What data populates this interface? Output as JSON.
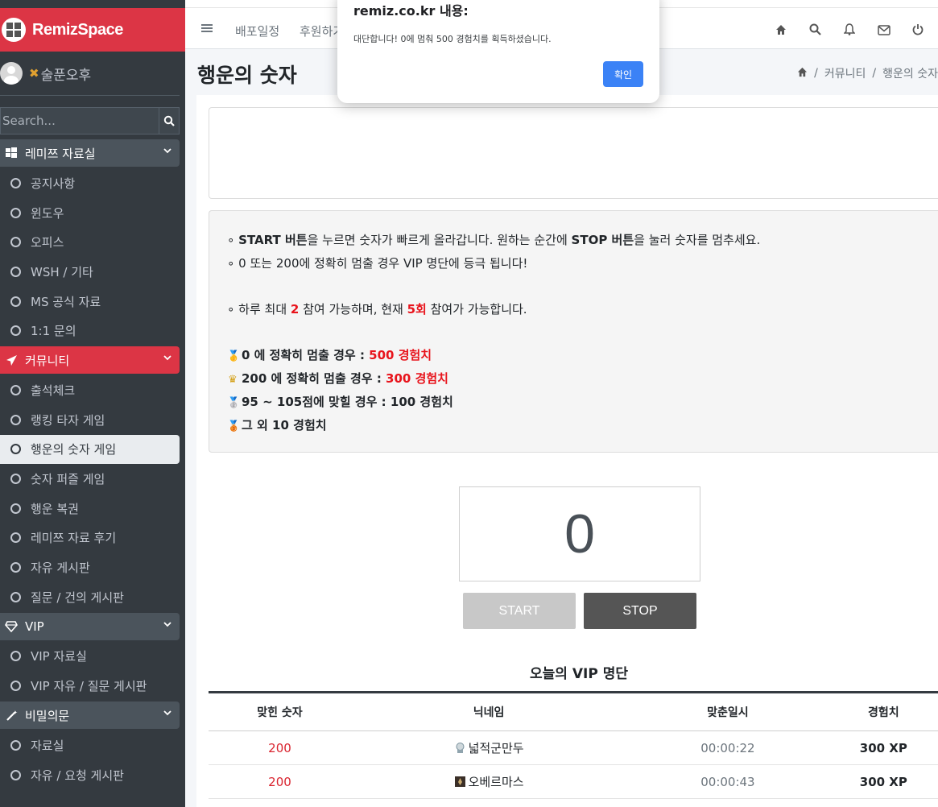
{
  "brand": {
    "name": "RemizSpace"
  },
  "user": {
    "name": "술푼오후"
  },
  "search": {
    "placeholder": "Search..."
  },
  "nav": {
    "sections": [
      {
        "label": "레미쯔 자료실",
        "items": [
          "공지사항",
          "윈도우",
          "오피스",
          "WSH / 기타",
          "MS 공식 자료",
          "1:1 문의"
        ]
      },
      {
        "label": "커뮤니티",
        "items": [
          "출석체크",
          "랭킹 타자 게임",
          "행운의 숫자 게임",
          "숫자 퍼즐 게임",
          "행운 복권",
          "레미쯔 자료 후기",
          "자유 게시판",
          "질문 / 건의 게시판"
        ]
      },
      {
        "label": "VIP",
        "items": [
          "VIP 자료실",
          "VIP 자유 / 질문 게시판"
        ]
      },
      {
        "label": "비밀의문",
        "items": [
          "자료실",
          "자유 / 요청 게시판"
        ]
      }
    ]
  },
  "topbar": {
    "links": [
      "배포일정",
      "후원하기"
    ]
  },
  "page": {
    "title": "행운의 숫자"
  },
  "breadcrumb": {
    "parent": "커뮤니티",
    "current": "행운의 숫자"
  },
  "info": {
    "l1_a": "START 버튼",
    "l1_b": "을 누르면 숫자가 빠르게 올라갑니다. 원하는 순간에 ",
    "l1_c": "STOP 버튼",
    "l1_d": "을 눌러 숫자를 멈추세요.",
    "l2": "0 또는 200에 정확히 멈출 경우 VIP 명단에 등극 됩니다!",
    "l3_a": "하루 최대 ",
    "l3_b": "2",
    "l3_c": " 참여 가능하며, 현재 ",
    "l3_d": "5회",
    "l3_e": " 참여가 가능합니다.",
    "r1_a": "0 에 정확히 멈출 경우 : ",
    "r1_b": "500 경험치",
    "r2_a": "200 에 정확히 멈출 경우 : ",
    "r2_b": "300 경험치",
    "r3": "95 ~ 105점에 맞힐 경우 : 100 경험치",
    "r4": "그 외 10 경험치"
  },
  "game": {
    "number": "0",
    "start_label": "START",
    "stop_label": "STOP"
  },
  "vip": {
    "title": "오늘의 VIP 명단",
    "headers": [
      "맞힌 숫자",
      "닉네임",
      "맞춘일시",
      "경험치"
    ],
    "rows": [
      {
        "number": "200",
        "nickname": "넓적군만두",
        "time": "00:00:22",
        "xp": "300 XP"
      },
      {
        "number": "200",
        "nickname": "오베르마스",
        "time": "00:00:43",
        "xp": "300 XP"
      }
    ]
  },
  "alert": {
    "title": "remiz.co.kr 내용:",
    "message": "대단합니다! 0에 멈춰 500 경험치를 획득하셨습니다.",
    "ok_label": "확인"
  },
  "colors": {
    "brand": "#dc3545",
    "sidebar": "#343a40",
    "accent_red": "#e8141c",
    "dialog_button": "#3b82f6"
  }
}
